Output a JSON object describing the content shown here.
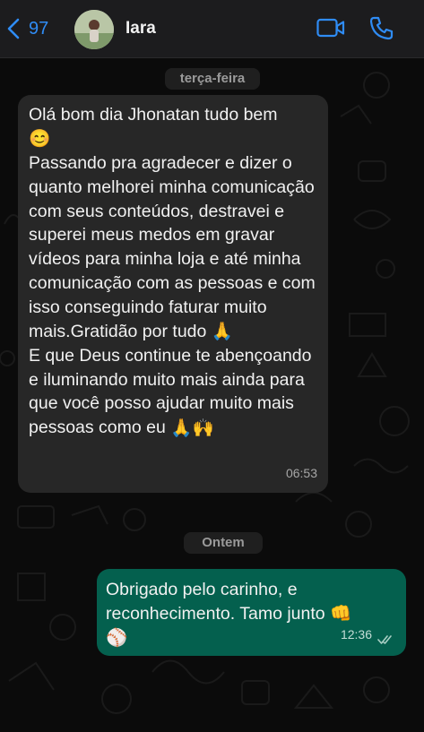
{
  "header": {
    "back_count": "97",
    "contact_name": "Iara"
  },
  "date_separators": [
    "terça-feira",
    "Ontem"
  ],
  "messages": [
    {
      "direction": "incoming",
      "text_1": "Olá bom dia Jhonatan tudo bem",
      "emoji_1": "😊",
      "text_2": "Passando pra agradecer e dizer o quanto melhorei minha comunicação com seus conteúdos, destravei  e superei meus medos em  gravar vídeos para minha loja e até minha comunicação com as pessoas e com isso conseguindo faturar muito mais.Gratidão por tudo",
      "emoji_2": "🙏",
      "text_3": "E que Deus continue te abençoando e iluminando muito mais ainda para que você posso ajudar muito mais pessoas  como eu",
      "emoji_3": "🙏🙌",
      "time": "06:53"
    },
    {
      "direction": "outgoing",
      "text_1": "Obrigado pelo carinho, e reconhecimento. Tamo junto",
      "emoji_1": "👊",
      "emoji_2": "⚾",
      "time": "12:36",
      "status": "read"
    }
  ],
  "colors": {
    "background": "#0b0b0b",
    "header": "#1c1c1e",
    "accent": "#2f8cf5",
    "incoming_bubble": "#272727",
    "outgoing_bubble": "#04604e"
  }
}
